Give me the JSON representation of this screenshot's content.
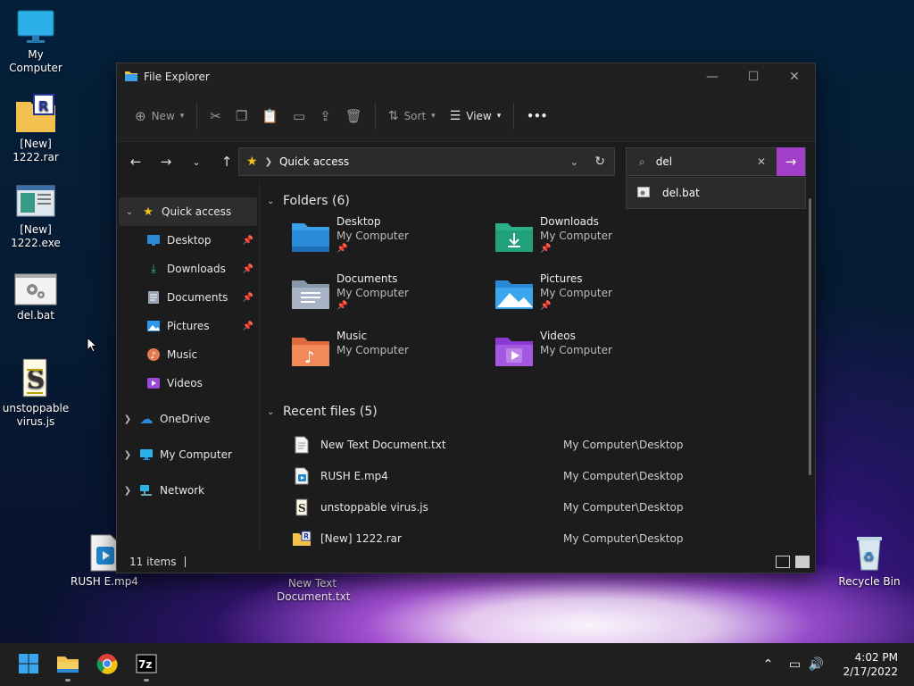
{
  "desktop": {
    "icons": [
      {
        "label": "My Computer"
      },
      {
        "label": "[New]\n1222.rar"
      },
      {
        "label": "[New]\n1222.exe"
      },
      {
        "label": "del.bat"
      },
      {
        "label": "unstoppable\nvirus.js"
      },
      {
        "label": "RUSH E.mp4"
      },
      {
        "label": "New Text\nDocument.txt"
      },
      {
        "label": "Recycle Bin"
      }
    ]
  },
  "window": {
    "title": "File Explorer",
    "toolbar": {
      "new_label": "New",
      "sort_label": "Sort",
      "view_label": "View",
      "more_label": "•••"
    },
    "address": {
      "path": "Quick access"
    },
    "search": {
      "value": "del",
      "suggestion": "del.bat"
    },
    "sidebar": {
      "items": [
        {
          "label": "Quick access"
        },
        {
          "label": "Desktop"
        },
        {
          "label": "Downloads"
        },
        {
          "label": "Documents"
        },
        {
          "label": "Pictures"
        },
        {
          "label": "Music"
        },
        {
          "label": "Videos"
        },
        {
          "label": "OneDrive"
        },
        {
          "label": "My Computer"
        },
        {
          "label": "Network"
        }
      ]
    },
    "folders_header": "Folders (6)",
    "folders": [
      {
        "name": "Desktop",
        "location": "My Computer",
        "pinned": "📌"
      },
      {
        "name": "Downloads",
        "location": "My Computer",
        "pinned": "📌"
      },
      {
        "name": "Documents",
        "location": "My Computer",
        "pinned": "📌"
      },
      {
        "name": "Pictures",
        "location": "My Computer",
        "pinned": "📌"
      },
      {
        "name": "Music",
        "location": "My Computer"
      },
      {
        "name": "Videos",
        "location": "My Computer"
      }
    ],
    "recent_header": "Recent files (5)",
    "recent_files": [
      {
        "name": "New Text Document.txt",
        "location": "My Computer\\Desktop"
      },
      {
        "name": "RUSH E.mp4",
        "location": "My Computer\\Desktop"
      },
      {
        "name": "unstoppable virus.js",
        "location": "My Computer\\Desktop"
      },
      {
        "name": "[New] 1222.rar",
        "location": "My Computer\\Desktop"
      }
    ],
    "status": {
      "items": "11 items"
    }
  },
  "taskbar": {
    "time": "4:02 PM",
    "date": "2/17/2022"
  },
  "colors": {
    "accent": "#a040c8",
    "folder_yellow": "#f2c14e",
    "folder_blue": "#3aa0e8"
  }
}
